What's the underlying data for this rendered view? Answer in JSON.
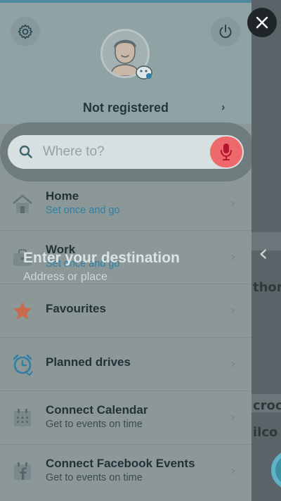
{
  "header": {
    "status_label": "Not registered",
    "status_arrow": "›"
  },
  "search": {
    "placeholder": "Where to?"
  },
  "menu": {
    "items": [
      {
        "title": "Home",
        "subtitle": "Set once and go",
        "icon": "home-icon"
      },
      {
        "title": "Work",
        "subtitle": "Set once and go",
        "icon": "briefcase-icon"
      },
      {
        "title": "Favourites",
        "subtitle": "",
        "icon": "star-icon"
      },
      {
        "title": "Planned drives",
        "subtitle": "",
        "icon": "alarm-clock-icon"
      },
      {
        "title": "Connect Calendar",
        "subtitle": "Get to events on time",
        "icon": "calendar-icon"
      },
      {
        "title": "Connect Facebook Events",
        "subtitle": "Get to events on time",
        "icon": "facebook-calendar-icon"
      }
    ],
    "arrow": "›"
  },
  "hint": {
    "title": "Enter your destination",
    "subtitle": "Address or place"
  },
  "map": {
    "labels": [
      "thorn",
      "crock",
      "ilco"
    ],
    "expand_arrow": "‹"
  },
  "colors": {
    "accent": "#2d7fa3",
    "mic": "#ee6a6a",
    "star": "#c76a4d"
  }
}
